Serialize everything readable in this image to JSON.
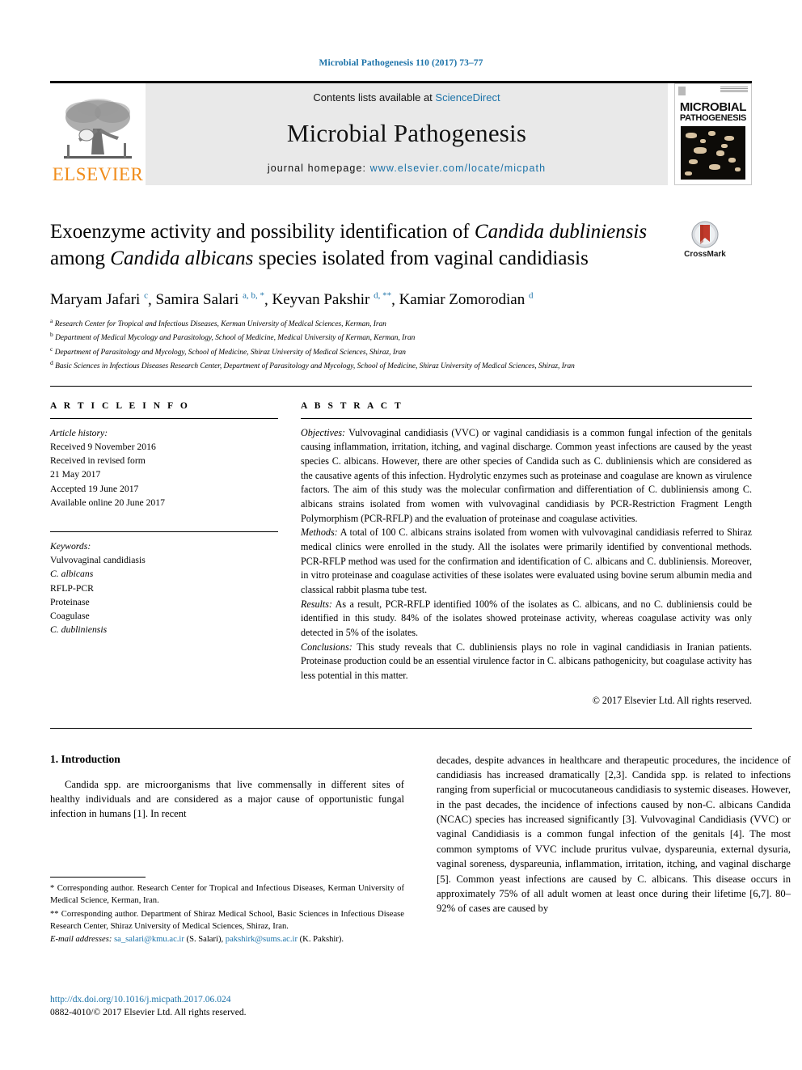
{
  "running_head": "Microbial Pathogenesis 110 (2017) 73–77",
  "masthead": {
    "publisher_name": "ELSEVIER",
    "contents_prefix": "Contents lists available at ",
    "contents_link": "ScienceDirect",
    "journal_name": "Microbial Pathogenesis",
    "homepage_prefix": "journal homepage: ",
    "homepage_url": "www.elsevier.com/locate/micpath",
    "cover": {
      "title_line1": "MICROBIAL",
      "title_line2": "PATHOGENESIS"
    },
    "link_color": "#1b72a8",
    "band_color": "#e9e9e9",
    "elsevier_orange": "#f08c1b"
  },
  "article": {
    "title_part1": "Exoenzyme activity and possibility identification of ",
    "title_italic1": "Candida dubliniensis",
    "title_part2": " among ",
    "title_italic2": "Candida albicans",
    "title_part3": " species isolated from vaginal candidiasis",
    "crossmark_label": "CrossMark",
    "authors": [
      {
        "name": "Maryam Jafari",
        "sup": "c"
      },
      {
        "name": "Samira Salari",
        "sup": "a, b, *"
      },
      {
        "name": "Keyvan Pakshir",
        "sup": "d, **"
      },
      {
        "name": "Kamiar Zomorodian",
        "sup": "d"
      }
    ],
    "affiliations": [
      {
        "mark": "a",
        "text": "Research Center for Tropical and Infectious Diseases, Kerman University of Medical Sciences, Kerman, Iran"
      },
      {
        "mark": "b",
        "text": "Department of Medical Mycology and Parasitology, School of Medicine, Medical University of Kerman, Kerman, Iran"
      },
      {
        "mark": "c",
        "text": "Department of Parasitology and Mycology, School of Medicine, Shiraz University of Medical Sciences, Shiraz, Iran"
      },
      {
        "mark": "d",
        "text": "Basic Sciences in Infectious Diseases Research Center, Department of Parasitology and Mycology, School of Medicine, Shiraz University of Medical Sciences, Shiraz, Iran"
      }
    ]
  },
  "article_info": {
    "heading": "A R T I C L E   I N F O",
    "history_label": "Article history:",
    "history": [
      "Received 9 November 2016",
      "Received in revised form",
      "21 May 2017",
      "Accepted 19 June 2017",
      "Available online 20 June 2017"
    ],
    "keywords_label": "Keywords:",
    "keywords": [
      "Vulvovaginal candidiasis",
      "C. albicans",
      "RFLP-PCR",
      "Proteinase",
      "Coagulase",
      "C. dubliniensis"
    ]
  },
  "abstract": {
    "heading": "A B S T R A C T",
    "objectives_label": "Objectives:",
    "objectives_text": " Vulvovaginal candidiasis (VVC) or vaginal candidiasis is a common fungal infection of the genitals causing inflammation, irritation, itching, and vaginal discharge. Common yeast infections are caused by the yeast species C. albicans. However, there are other species of Candida such as C. dubliniensis which are considered as the causative agents of this infection. Hydrolytic enzymes such as proteinase and coagulase are known as virulence factors. The aim of this study was the molecular confirmation and differentiation of C. dubliniensis among C. albicans strains isolated from women with vulvovaginal candidiasis by PCR-Restriction Fragment Length Polymorphism (PCR-RFLP) and the evaluation of proteinase and coagulase activities.",
    "methods_label": "Methods:",
    "methods_text": " A total of 100 C. albicans strains isolated from women with vulvovaginal candidiasis referred to Shiraz medical clinics were enrolled in the study. All the isolates were primarily identified by conventional methods. PCR-RFLP method was used for the confirmation and identification of C. albicans and C. dubliniensis. Moreover, in vitro proteinase and coagulase activities of these isolates were evaluated using bovine serum albumin media and classical rabbit plasma tube test.",
    "results_label": "Results:",
    "results_text": " As a result, PCR-RFLP identified 100% of the isolates as C. albicans, and no C. dubliniensis could be identified in this study. 84% of the isolates showed proteinase activity, whereas coagulase activity was only detected in 5% of the isolates.",
    "conclusions_label": "Conclusions:",
    "conclusions_text": " This study reveals that C. dubliniensis plays no role in vaginal candidiasis in Iranian patients. Proteinase production could be an essential virulence factor in C. albicans pathogenicity, but coagulase activity has less potential in this matter.",
    "copyright": "© 2017 Elsevier Ltd. All rights reserved."
  },
  "introduction": {
    "heading": "1. Introduction",
    "left_paragraph": "Candida spp. are microorganisms that live commensally in different sites of healthy individuals and are considered as a major cause of opportunistic fungal infection in humans [1]. In recent",
    "right_paragraph": "decades, despite advances in healthcare and therapeutic procedures, the incidence of candidiasis has increased dramatically [2,3]. Candida spp. is related to infections ranging from superficial or mucocutaneous candidiasis to systemic diseases. However, in the past decades, the incidence of infections caused by non-C. albicans Candida (NCAC) species has increased significantly [3]. Vulvovaginal Candidiasis (VVC) or vaginal Candidiasis is a common fungal infection of the genitals [4]. The most common symptoms of VVC include pruritus vulvae, dyspareunia, external dysuria, vaginal soreness, dyspareunia, inflammation, irritation, itching, and vaginal discharge [5]. Common yeast infections are caused by C. albicans. This disease occurs in approximately 75% of all adult women at least once during their lifetime [6,7]. 80–92% of cases are caused by"
  },
  "footnotes": {
    "corr1": "* Corresponding author. Research Center for Tropical and Infectious Diseases, Kerman University of Medical Science, Kerman, Iran.",
    "corr2": "** Corresponding author. Department of Shiraz Medical School, Basic Sciences in Infectious Disease Research Center, Shiraz University of Medical Sciences, Shiraz, Iran.",
    "email_label": "E-mail addresses:",
    "email1": "sa_salari@kmu.ac.ir",
    "email1_owner": " (S. Salari), ",
    "email2": "pakshirk@sums.ac.ir",
    "email2_owner": " (K. Pakshir)."
  },
  "footer": {
    "doi": "http://dx.doi.org/10.1016/j.micpath.2017.06.024",
    "issn": "0882-4010/© 2017 Elsevier Ltd. All rights reserved."
  }
}
